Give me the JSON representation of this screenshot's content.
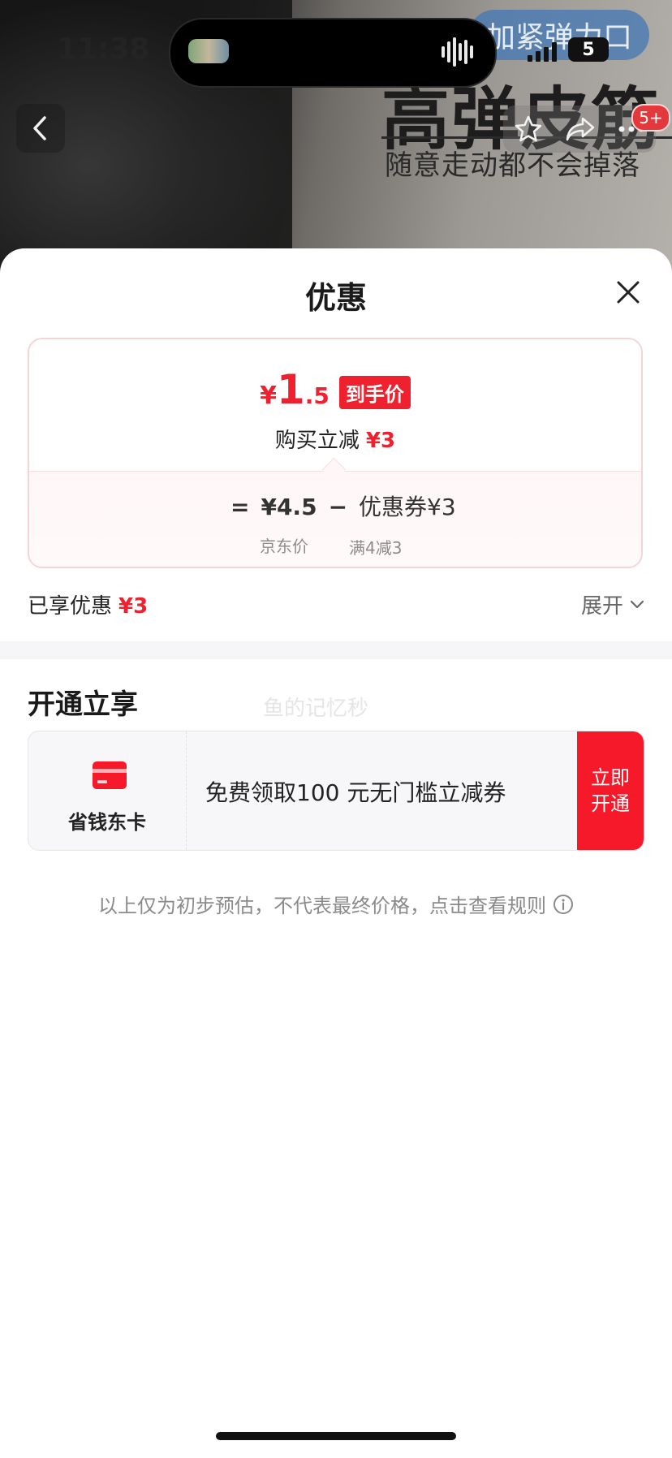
{
  "status_bar": {
    "time": "11:38",
    "battery": "5"
  },
  "background": {
    "promo_pill": "加紧弹力口",
    "promo_headline": "高弹皮筋",
    "promo_subline": "随意走动都不会掉落",
    "cart_badge": "5+"
  },
  "sheet": {
    "title": "优惠",
    "final_price": {
      "symbol": "¥",
      "integer": "1",
      "decimal": ".5",
      "tag": "到手价"
    },
    "instant_discount": {
      "label": "购买立减",
      "amount": "¥3"
    },
    "formula": {
      "equals": "=",
      "jd_price": "¥4.5",
      "minus": "−",
      "coupon": "优惠券¥3",
      "jd_price_label": "京东价",
      "coupon_label": "满4减3"
    },
    "enjoyed": {
      "label": "已享优惠",
      "amount": "¥3"
    },
    "expand_label": "展开",
    "section_title": "开通立享",
    "watermark": "鱼的记忆秒",
    "membership": {
      "card_name": "省钱东卡",
      "description": "免费领取100 元无门槛立减券",
      "button_label": "立即开通"
    },
    "disclaimer": "以上仅为初步预估，不代表最终价格，点击查看规则"
  },
  "colors": {
    "accent_red": "#f0212e",
    "button_red": "#f5192a"
  }
}
